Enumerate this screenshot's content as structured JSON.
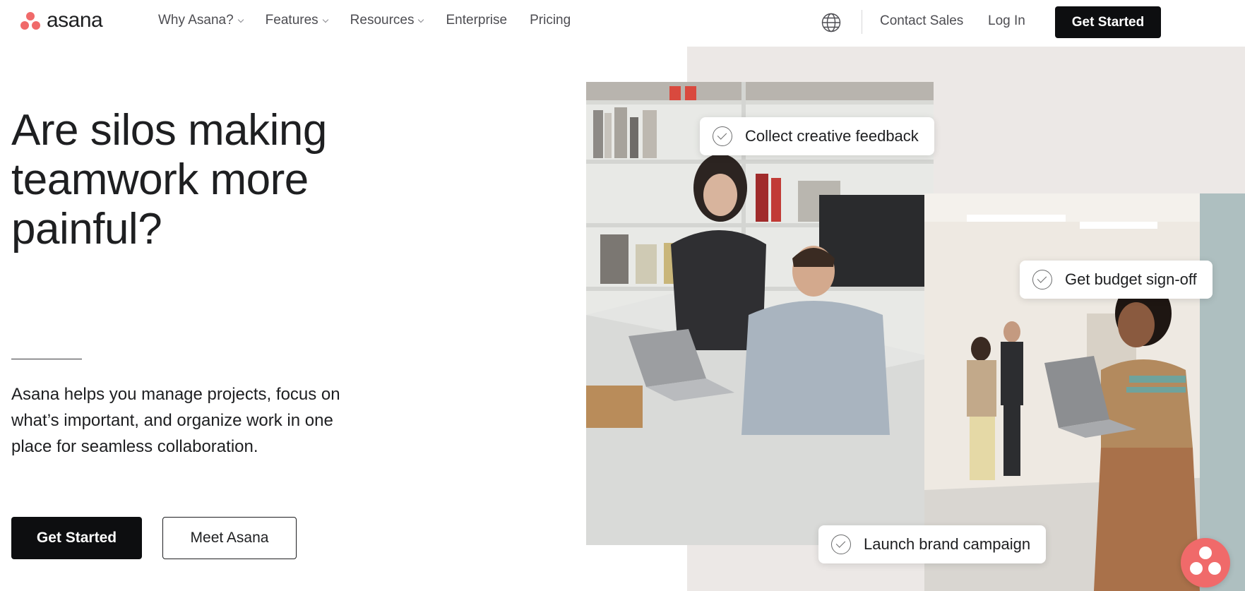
{
  "brand": {
    "name": "asana",
    "accent_color": "#f06a6a",
    "dark_color": "#0d0e10"
  },
  "nav": {
    "items": [
      {
        "label": "Why Asana?",
        "has_dropdown": true
      },
      {
        "label": "Features",
        "has_dropdown": true
      },
      {
        "label": "Resources",
        "has_dropdown": true
      },
      {
        "label": "Enterprise",
        "has_dropdown": false
      },
      {
        "label": "Pricing",
        "has_dropdown": false
      }
    ],
    "language_icon": "globe-icon",
    "contact_sales": "Contact Sales",
    "log_in": "Log In",
    "get_started": "Get Started"
  },
  "hero": {
    "headline": "Are silos making teamwork more painful?",
    "description": "Asana helps you manage projects, focus on what’s important, and organize work in one place for seamless collaboration.",
    "primary_cta": "Get Started",
    "secondary_cta": "Meet Asana"
  },
  "task_cards": [
    {
      "label": "Collect creative feedback",
      "icon": "check-circle-icon"
    },
    {
      "label": "Get budget sign-off",
      "icon": "check-circle-icon"
    },
    {
      "label": "Launch brand campaign",
      "icon": "check-circle-icon"
    }
  ],
  "help_widget": {
    "icon": "asana-dots-icon"
  }
}
